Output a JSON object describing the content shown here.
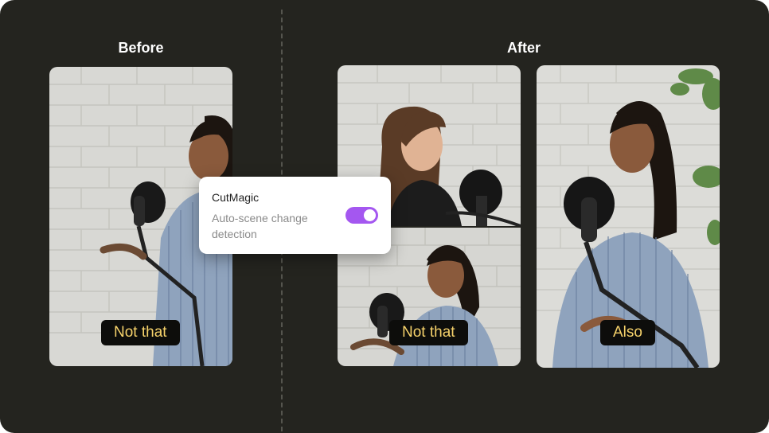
{
  "labels": {
    "before": "Before",
    "after": "After"
  },
  "captions": {
    "before_panel": "Not that",
    "after_bottom_panel": "Not that",
    "after_right_panel": "Also"
  },
  "card": {
    "title": "CutMagic",
    "subtitle": "Auto-scene change detection",
    "toggle_on": true
  },
  "colors": {
    "background": "#24241f",
    "caption_text": "#f6d26b",
    "caption_bg": "#0d0d0b",
    "toggle_accent": "#a457f0"
  }
}
